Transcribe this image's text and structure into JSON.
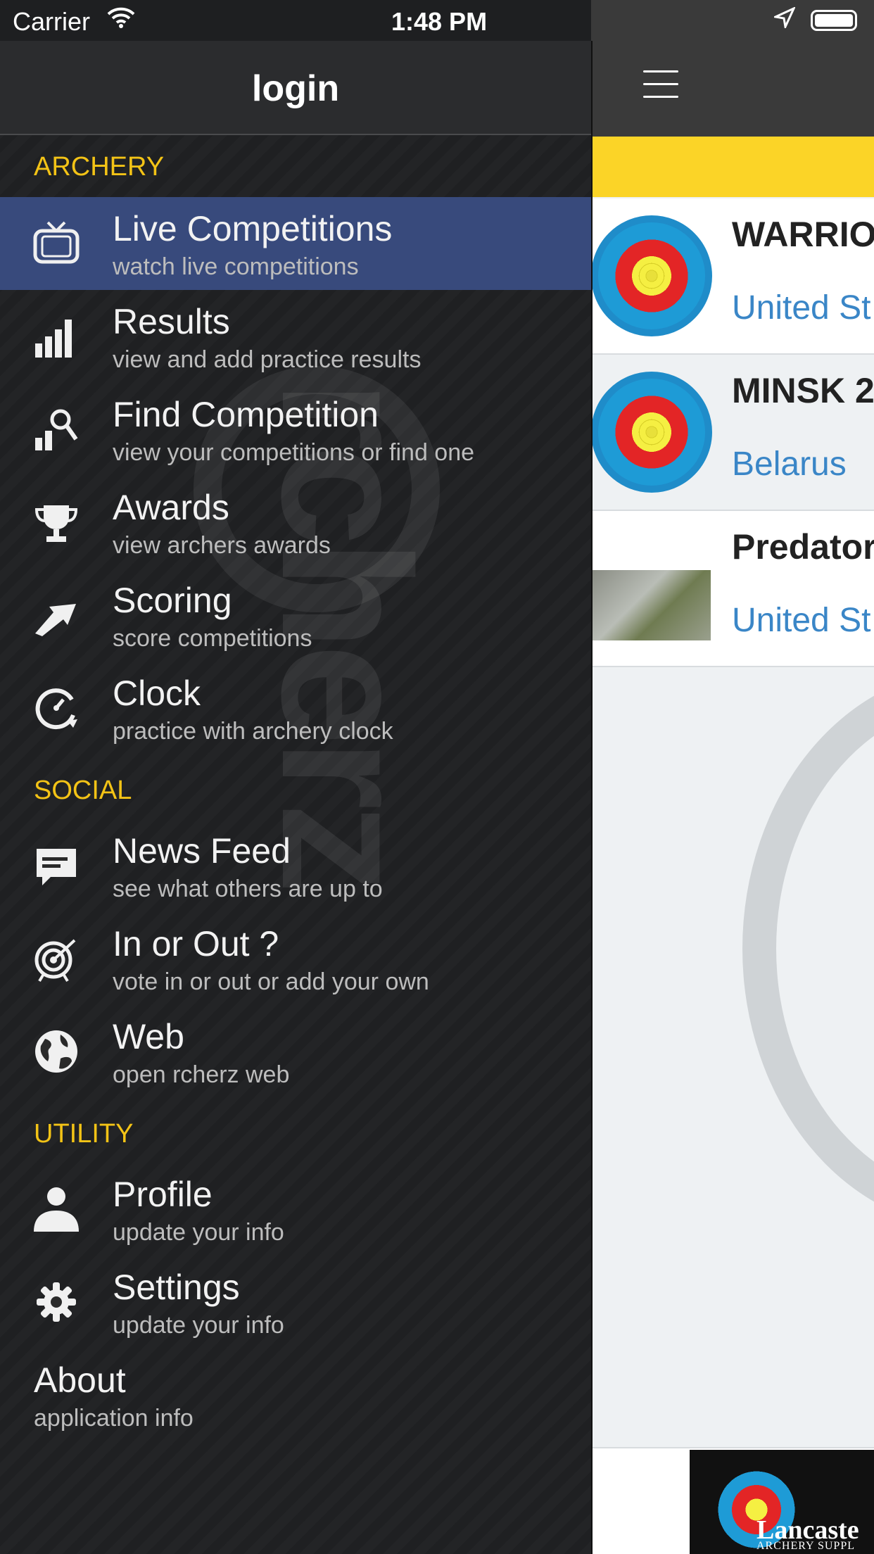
{
  "status_bar": {
    "carrier": "Carrier",
    "time": "1:48 PM"
  },
  "drawer": {
    "title": "login",
    "sections": {
      "archery": "ARCHERY",
      "social": "SOCIAL",
      "utility": "UTILITY"
    },
    "items": [
      {
        "title": "Live Competitions",
        "subtitle": "watch live competitions",
        "icon": "tv-icon"
      },
      {
        "title": "Results",
        "subtitle": "view and add practice results",
        "icon": "bar-chart-icon"
      },
      {
        "title": "Find Competition",
        "subtitle": "view your competitions or find one",
        "icon": "chart-search-icon"
      },
      {
        "title": "Awards",
        "subtitle": "view archers awards",
        "icon": "trophy-icon"
      },
      {
        "title": "Scoring",
        "subtitle": "score competitions",
        "icon": "arrow-up-icon"
      },
      {
        "title": "Clock",
        "subtitle": "practice with archery clock",
        "icon": "clock-icon"
      },
      {
        "title": "News Feed",
        "subtitle": "see what others are up to",
        "icon": "chat-icon"
      },
      {
        "title": "In or Out ?",
        "subtitle": "vote in or out or add your own",
        "icon": "target-icon"
      },
      {
        "title": "Web",
        "subtitle": "open rcherz web",
        "icon": "globe-icon"
      },
      {
        "title": "Profile",
        "subtitle": "update your info",
        "icon": "user-icon"
      },
      {
        "title": "Settings",
        "subtitle": "update your info",
        "icon": "gear-icon"
      },
      {
        "title": "About",
        "subtitle": "application info"
      }
    ],
    "watermark": "rcherz"
  },
  "content": {
    "competitions": [
      {
        "title": "WARRIO",
        "country": "United St"
      },
      {
        "title": "MINSK 2",
        "country": "Belarus"
      },
      {
        "title": "Predator",
        "country": "United St"
      }
    ],
    "ad": {
      "title": "Lancaste",
      "subtitle": "ARCHERY SUPPL"
    }
  }
}
